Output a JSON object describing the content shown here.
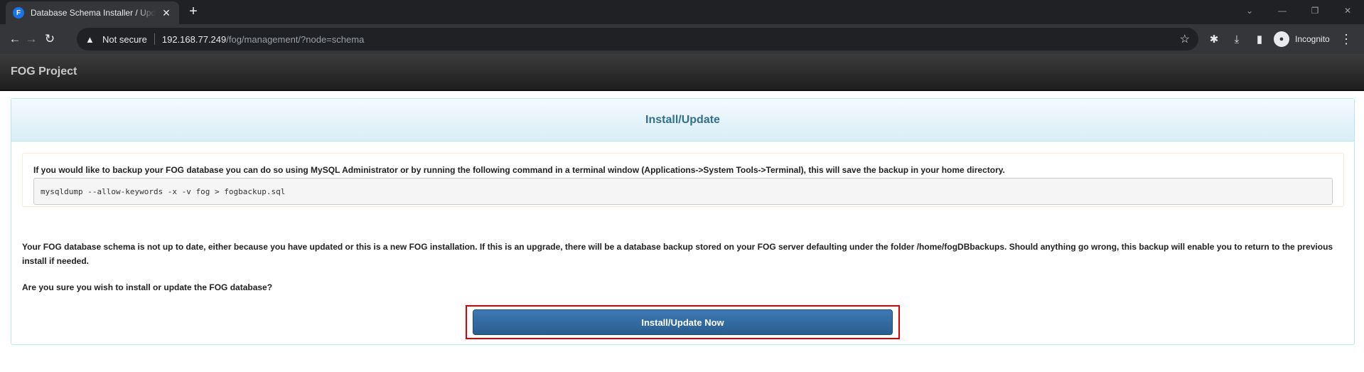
{
  "browser": {
    "tab_title": "Database Schema Installer / Update",
    "favicon_letter": "F",
    "security_label": "Not secure",
    "url_host": "192.168.77.249",
    "url_path": "/fog/management/?node=schema",
    "profile_label": "Incognito",
    "icons": [
      "back-icon",
      "forward-icon",
      "reload-icon",
      "warning-icon",
      "star-icon",
      "extensions-icon",
      "download-icon",
      "sidepanel-icon",
      "incognito-icon",
      "menu-icon",
      "close-icon",
      "plus-icon",
      "minimize-icon",
      "restore-icon"
    ]
  },
  "app": {
    "brand": "FOG Project"
  },
  "panel": {
    "title": "Install/Update",
    "backup_text": "If you would like to backup your FOG database you can do so using MySQL Administrator or by running the following command in a terminal window (Applications->System Tools->Terminal), this will save the backup in your home directory.",
    "backup_command": "mysqldump --allow-keywords -x -v fog > fogbackup.sql",
    "info_text": "Your FOG database schema is not up to date, either because you have updated or this is a new FOG installation. If this is an upgrade, there will be a database backup stored on your FOG server defaulting under the folder /home/fogDBbackups. Should anything go wrong, this backup will enable you to return to the previous install if needed.",
    "confirm_text": "Are you sure you wish to install or update the FOG database?",
    "button_label": "Install/Update Now"
  },
  "colors": {
    "accent": "#31708f",
    "button": "#2a5d8f",
    "highlight": "#e00000"
  }
}
